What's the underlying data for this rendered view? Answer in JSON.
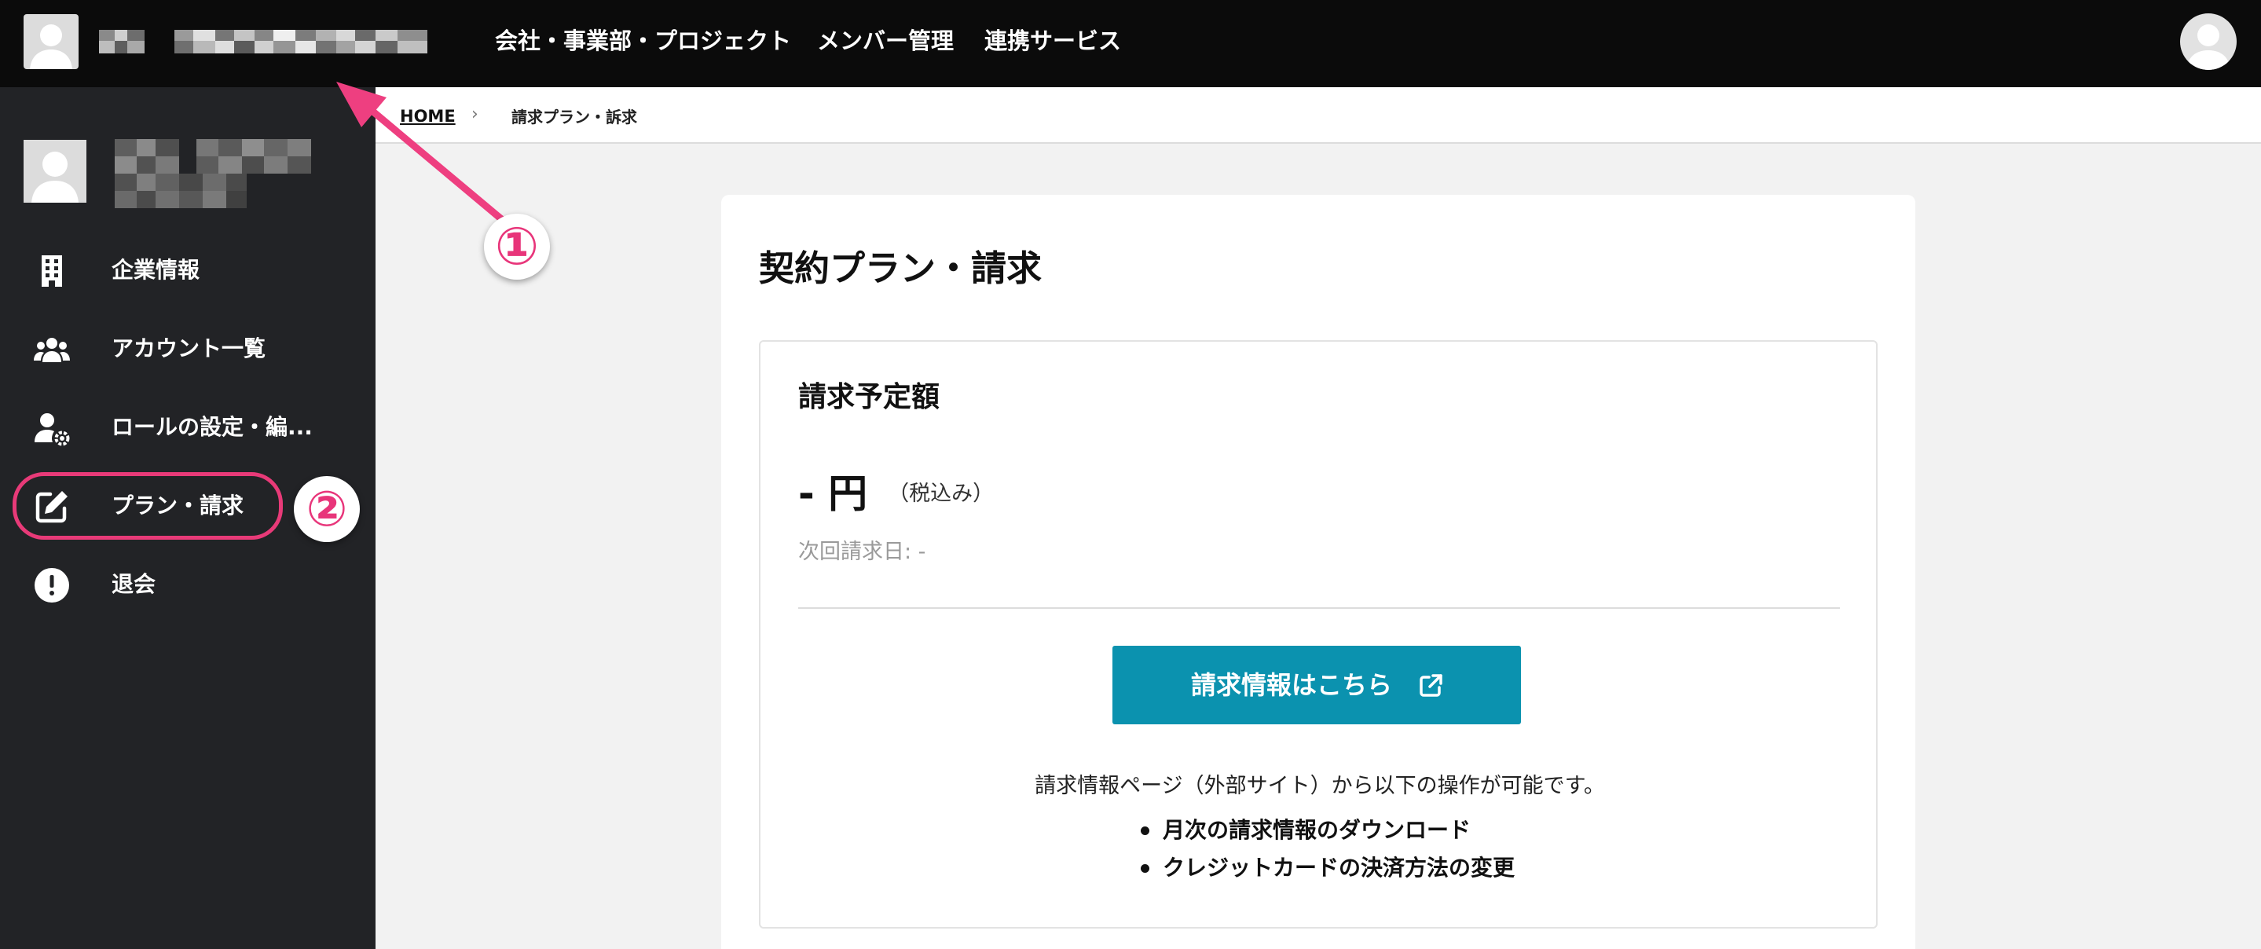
{
  "topbar": {
    "nav": [
      {
        "label": "会社・事業部・プロジェクト"
      },
      {
        "label": "メンバー管理"
      },
      {
        "label": "連携サービス"
      }
    ]
  },
  "sidebar": {
    "items": [
      {
        "label": "企業情報",
        "icon": "building-icon"
      },
      {
        "label": "アカウント一覧",
        "icon": "users-icon"
      },
      {
        "label": "ロールの設定・編...",
        "icon": "user-settings-icon"
      },
      {
        "label": "プラン・請求",
        "icon": "edit-icon"
      },
      {
        "label": "退会",
        "icon": "exclamation-circle-icon"
      }
    ]
  },
  "breadcrumb": {
    "home": "HOME",
    "separator": "›",
    "current": "請求プラン・訴求"
  },
  "main": {
    "title": "契約プラン・請求",
    "billing": {
      "title": "請求予定額",
      "amount": "- 円",
      "tax_note": "（税込み）",
      "next_date": "次回請求日: -",
      "cta_label": "請求情報はこちら",
      "description": "請求情報ページ（外部サイト）から以下の操作が可能です。",
      "features": [
        "月次の請求情報のダウンロード",
        "クレジットカードの決済方法の変更"
      ]
    }
  },
  "annotations": {
    "badge_1": "①",
    "badge_2": "②"
  },
  "colors": {
    "accent": "#0b92af",
    "highlight": "#e83a78",
    "topbar": "#0b0b0b",
    "sidebar": "#222326"
  }
}
